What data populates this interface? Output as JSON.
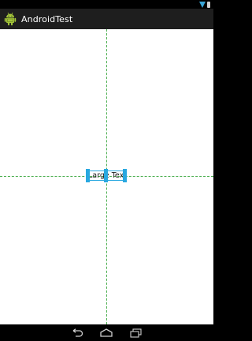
{
  "status_bar": {
    "icons": [
      "wifi-icon",
      "battery-icon"
    ],
    "icon_color": "#3aa6d8"
  },
  "action_bar": {
    "title": "AndroidTest",
    "icon": "android-icon",
    "background": "#1e1e1e"
  },
  "content": {
    "background": "#ffffff",
    "text_view": {
      "text": "Large Text"
    },
    "guide_color": "#4caf50",
    "selection_color": "#29a8e0"
  },
  "nav_bar": {
    "buttons": [
      {
        "name": "back",
        "icon": "back-icon"
      },
      {
        "name": "home",
        "icon": "home-icon"
      },
      {
        "name": "recents",
        "icon": "recents-icon"
      }
    ]
  }
}
